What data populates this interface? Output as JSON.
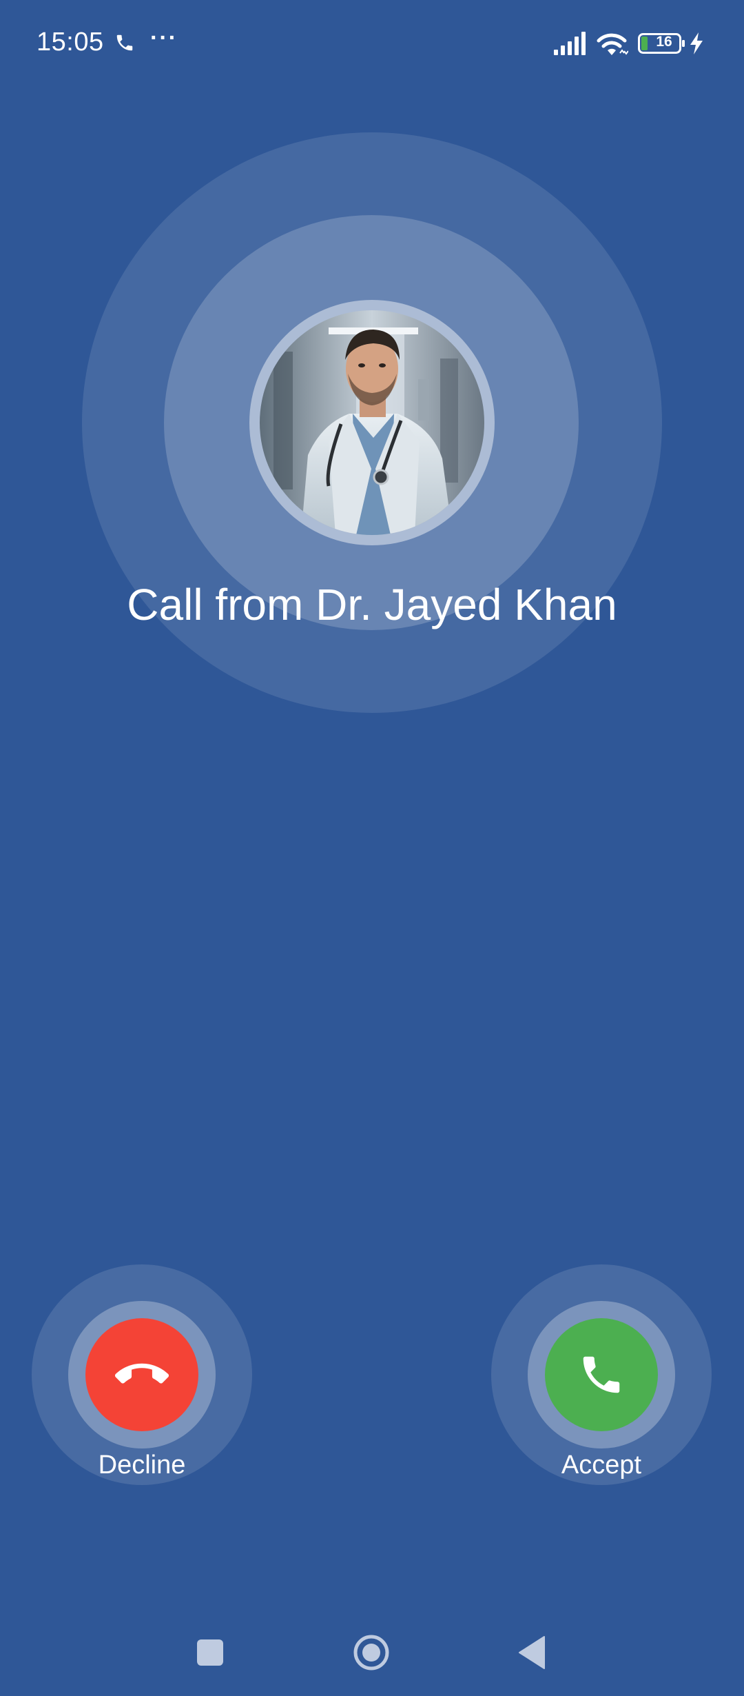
{
  "status_bar": {
    "time": "15:05",
    "more_indicator": "···",
    "battery_level": "16",
    "icons": [
      "phone-icon",
      "signal-icon",
      "wifi-icon",
      "battery-icon",
      "charging-bolt-icon"
    ]
  },
  "call": {
    "caller_label": "Call from Dr. Jayed Khan"
  },
  "actions": {
    "decline_label": "Decline",
    "accept_label": "Accept"
  },
  "colors": {
    "background": "#2f5797",
    "decline": "#f44336",
    "accept": "#4caf50"
  },
  "nav_bar": {
    "icons": [
      "recents-square-icon",
      "home-circle-icon",
      "back-triangle-icon"
    ]
  }
}
